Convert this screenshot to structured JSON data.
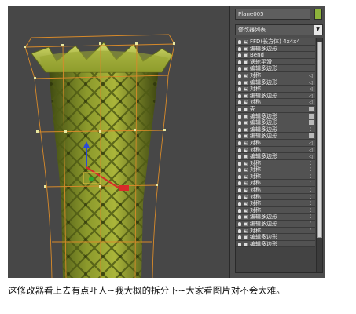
{
  "object_name": "Plane005",
  "object_color": "#8db33b",
  "modifier_list_label": "修改器列表",
  "modifier_stack": [
    {
      "label": "FFD(长方体) 4x4x4",
      "box": "plus",
      "tail": ""
    },
    {
      "label": "编辑多边形",
      "box": "plain",
      "tail": ""
    },
    {
      "label": "Bend",
      "box": "plain",
      "tail": ""
    },
    {
      "label": "涡轮平滑",
      "box": "plain",
      "tail": ""
    },
    {
      "label": "编辑多边形",
      "box": "plain",
      "tail": ""
    },
    {
      "label": "对称",
      "box": "plus",
      "tail": "wand"
    },
    {
      "label": "编辑多边形",
      "box": "plain",
      "tail": "wand"
    },
    {
      "label": "对称",
      "box": "plus",
      "tail": "wand"
    },
    {
      "label": "编辑多边形",
      "box": "plain",
      "tail": "wand"
    },
    {
      "label": "对称",
      "box": "plus",
      "tail": "wand"
    },
    {
      "label": "壳",
      "box": "plain",
      "tail": "square"
    },
    {
      "label": "编辑多边形",
      "box": "plain",
      "tail": "square"
    },
    {
      "label": "编辑多边形",
      "box": "plain",
      "tail": "square"
    },
    {
      "label": "编辑多边形",
      "box": "plain",
      "tail": "dots"
    },
    {
      "label": "编辑多边形",
      "box": "plain",
      "tail": "square"
    },
    {
      "label": "对称",
      "box": "plus",
      "tail": "wand"
    },
    {
      "label": "对称",
      "box": "plus",
      "tail": "wand"
    },
    {
      "label": "编辑多边形",
      "box": "plain",
      "tail": "wand"
    },
    {
      "label": "对称",
      "box": "plus",
      "tail": "dots"
    },
    {
      "label": "对称",
      "box": "plus",
      "tail": "dots"
    },
    {
      "label": "对称",
      "box": "plus",
      "tail": "dots"
    },
    {
      "label": "对称",
      "box": "plus",
      "tail": "dots"
    },
    {
      "label": "对称",
      "box": "plus",
      "tail": "dots"
    },
    {
      "label": "对称",
      "box": "plus",
      "tail": "dots"
    },
    {
      "label": "对称",
      "box": "plus",
      "tail": "dots"
    },
    {
      "label": "对称",
      "box": "plus",
      "tail": "dots"
    },
    {
      "label": "编辑多边形",
      "box": "plain",
      "tail": "dots"
    },
    {
      "label": "编辑多边形",
      "box": "plain",
      "tail": "dots"
    },
    {
      "label": "对称",
      "box": "plus",
      "tail": "dots"
    },
    {
      "label": "编辑多边形",
      "box": "plain",
      "tail": ""
    },
    {
      "label": "编辑多边形",
      "box": "plain",
      "tail": ""
    }
  ],
  "caption": "这修改器看上去有点吓人~我大概的拆分下~大家看图片对不会太难。"
}
